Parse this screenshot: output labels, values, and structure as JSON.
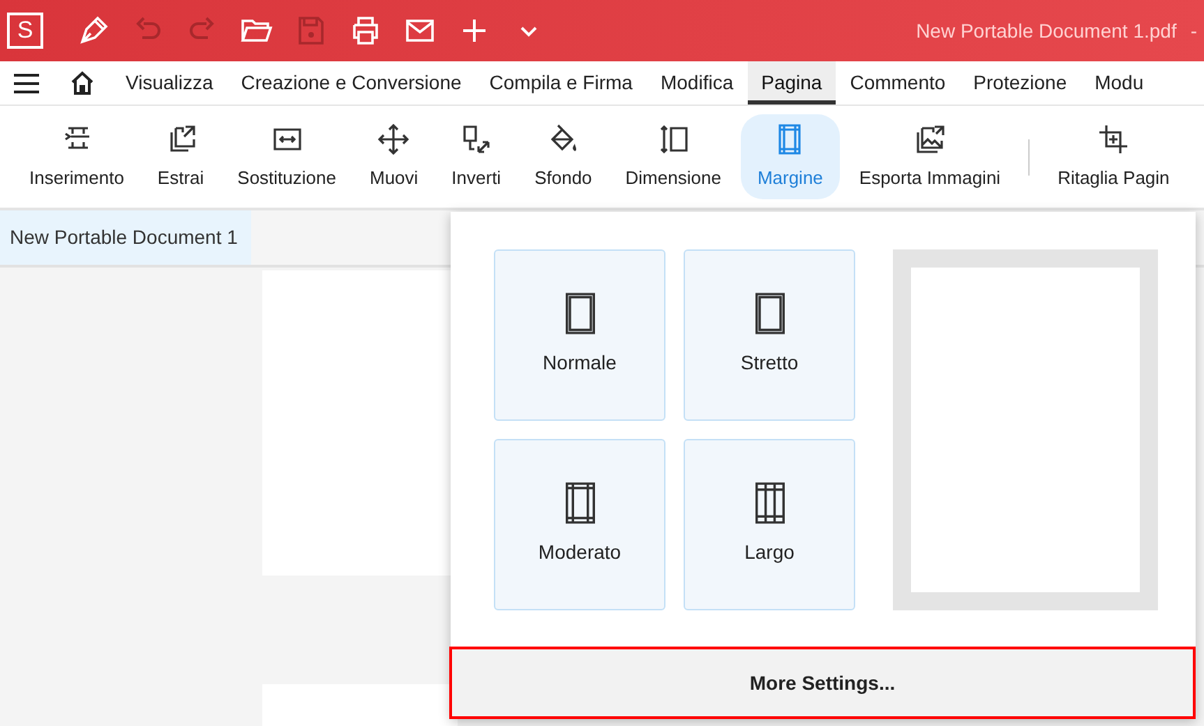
{
  "app": {
    "logo": "S",
    "title": "New Portable Document 1.pdf",
    "title_suffix": "-"
  },
  "quick_tools": [
    {
      "kind": "pen",
      "disabled": false
    },
    {
      "kind": "undo",
      "disabled": true
    },
    {
      "kind": "redo",
      "disabled": true
    },
    {
      "kind": "folder",
      "disabled": false
    },
    {
      "kind": "save",
      "disabled": true
    },
    {
      "kind": "print",
      "disabled": false
    },
    {
      "kind": "mail",
      "disabled": false
    },
    {
      "kind": "plus",
      "disabled": false
    },
    {
      "kind": "chevron",
      "disabled": false
    }
  ],
  "menu_tabs": [
    {
      "label": "Visualizza",
      "selected": false
    },
    {
      "label": "Creazione e Conversione",
      "selected": false
    },
    {
      "label": "Compila e Firma",
      "selected": false
    },
    {
      "label": "Modifica",
      "selected": false
    },
    {
      "label": "Pagina",
      "selected": true
    },
    {
      "label": "Commento",
      "selected": false
    },
    {
      "label": "Protezione",
      "selected": false
    },
    {
      "label": "Modu",
      "selected": false
    }
  ],
  "toolbar": [
    {
      "kind": "insert",
      "label": "Inserimento",
      "selected": false
    },
    {
      "kind": "extract",
      "label": "Estrai",
      "selected": false
    },
    {
      "kind": "replace",
      "label": "Sostituzione",
      "selected": false
    },
    {
      "kind": "move",
      "label": "Muovi",
      "selected": false
    },
    {
      "kind": "reverse",
      "label": "Inverti",
      "selected": false
    },
    {
      "kind": "background",
      "label": "Sfondo",
      "selected": false
    },
    {
      "kind": "size",
      "label": "Dimensione",
      "selected": false
    },
    {
      "kind": "margin",
      "label": "Margine",
      "selected": true
    },
    {
      "kind": "export",
      "label": "Esporta Immagini",
      "selected": false
    },
    {
      "kind": "crop",
      "label": "Ritaglia Pagin",
      "selected": false
    }
  ],
  "document_tab": {
    "label": "New Portable Document 1"
  },
  "margin_menu": {
    "options": [
      {
        "kind": "normal",
        "label": "Normale"
      },
      {
        "kind": "narrow",
        "label": "Stretto"
      },
      {
        "kind": "moderate",
        "label": "Moderato"
      },
      {
        "kind": "wide",
        "label": "Largo"
      }
    ],
    "more_button": "More Settings..."
  }
}
